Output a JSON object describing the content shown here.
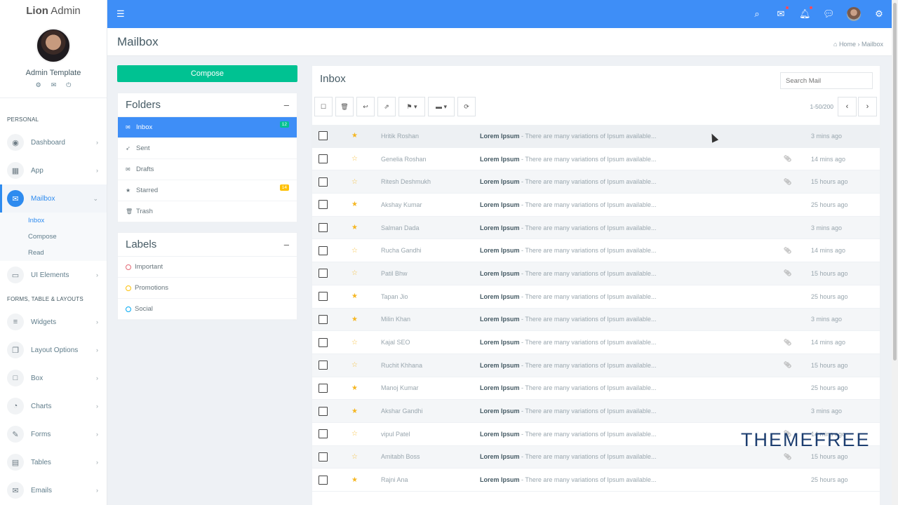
{
  "brand": {
    "bold": "Lion",
    "rest": " Admin"
  },
  "profile": {
    "name": "Admin Template"
  },
  "sidebar": {
    "section_personal": "PERSONAL",
    "section_forms": "FORMS, TABLE & LAYOUTS",
    "items_personal": [
      {
        "label": "Dashboard",
        "icon": "dashboard-icon",
        "glyph": "◉"
      },
      {
        "label": "App",
        "icon": "apps-grid-icon",
        "glyph": "▦"
      },
      {
        "label": "Mailbox",
        "icon": "envelope-icon",
        "glyph": "✉",
        "active": true
      }
    ],
    "mailbox_sub": [
      "Inbox",
      "Compose",
      "Read"
    ],
    "ui_elements": {
      "label": "UI Elements",
      "icon": "laptop-icon",
      "glyph": "▭"
    },
    "items_forms": [
      {
        "label": "Widgets",
        "icon": "list-icon",
        "glyph": "≡"
      },
      {
        "label": "Layout Options",
        "icon": "copy-icon",
        "glyph": "❐"
      },
      {
        "label": "Box",
        "icon": "square-icon",
        "glyph": "□"
      },
      {
        "label": "Charts",
        "icon": "pie-chart-icon",
        "glyph": "◔"
      },
      {
        "label": "Forms",
        "icon": "edit-icon",
        "glyph": "✎"
      },
      {
        "label": "Tables",
        "icon": "table-icon",
        "glyph": "▤"
      },
      {
        "label": "Emails",
        "icon": "open-envelope-icon",
        "glyph": "✉"
      }
    ]
  },
  "page": {
    "title": "Mailbox",
    "breadcrumb_home": "Home",
    "breadcrumb_sep": "›",
    "breadcrumb_current": "Mailbox"
  },
  "compose_label": "Compose",
  "folders": {
    "title": "Folders",
    "collapse": "–",
    "items": [
      {
        "label": "Inbox",
        "icon": "inbox-icon",
        "glyph": "✉",
        "badge": "12",
        "badge_color": "#00c292",
        "active": true
      },
      {
        "label": "Sent",
        "icon": "paper-plane-icon",
        "glyph": "➶"
      },
      {
        "label": "Drafts",
        "icon": "drafts-icon",
        "glyph": "✉"
      },
      {
        "label": "Starred",
        "icon": "star-icon",
        "glyph": "★",
        "badge": "14",
        "badge_color": "#fec107"
      },
      {
        "label": "Trash",
        "icon": "trash-icon",
        "glyph": "🗑"
      }
    ]
  },
  "labels": {
    "title": "Labels",
    "collapse": "–",
    "items": [
      {
        "label": "Important",
        "color": "#e46a76"
      },
      {
        "label": "Promotions",
        "color": "#fec107"
      },
      {
        "label": "Social",
        "color": "#03a9f3"
      }
    ]
  },
  "inbox": {
    "title": "Inbox",
    "search_placeholder": "Search Mail",
    "range": "1-50/200",
    "subject_bold": "Lorem Ipsum",
    "subject_rest": " - There are many variations of Ipsum available...",
    "rows": [
      {
        "sender": "Hritik Roshan",
        "starred": true,
        "attach": false,
        "time": "3 mins ago"
      },
      {
        "sender": "Genelia Roshan",
        "starred": false,
        "attach": true,
        "time": "14 mins ago"
      },
      {
        "sender": "Ritesh Deshmukh",
        "starred": false,
        "attach": true,
        "time": "15 hours ago"
      },
      {
        "sender": "Akshay Kumar",
        "starred": true,
        "attach": false,
        "time": "25 hours ago"
      },
      {
        "sender": "Salman Dada",
        "starred": true,
        "attach": false,
        "time": "3 mins ago"
      },
      {
        "sender": "Rucha Gandhi",
        "starred": false,
        "attach": true,
        "time": "14 mins ago"
      },
      {
        "sender": "Patil Bhw",
        "starred": false,
        "attach": true,
        "time": "15 hours ago"
      },
      {
        "sender": "Tapan Jio",
        "starred": true,
        "attach": false,
        "time": "25 hours ago"
      },
      {
        "sender": "Milin Khan",
        "starred": true,
        "attach": false,
        "time": "3 mins ago"
      },
      {
        "sender": "Kajal SEO",
        "starred": false,
        "attach": true,
        "time": "14 mins ago"
      },
      {
        "sender": "Ruchit Khhana",
        "starred": false,
        "attach": true,
        "time": "15 hours ago"
      },
      {
        "sender": "Manoj Kumar",
        "starred": true,
        "attach": false,
        "time": "25 hours ago"
      },
      {
        "sender": "Akshar Gandhi",
        "starred": true,
        "attach": false,
        "time": "3 mins ago"
      },
      {
        "sender": "vipul Patel",
        "starred": false,
        "attach": true,
        "time": "14 mins ago"
      },
      {
        "sender": "Amitabh Boss",
        "starred": false,
        "attach": true,
        "time": "15 hours ago"
      },
      {
        "sender": "Rajni Ana",
        "starred": true,
        "attach": false,
        "time": "25 hours ago"
      }
    ]
  },
  "watermark": "THEMEFREE",
  "colors": {
    "primary": "#3e8ef7",
    "success": "#00c292",
    "warning": "#fec107"
  }
}
